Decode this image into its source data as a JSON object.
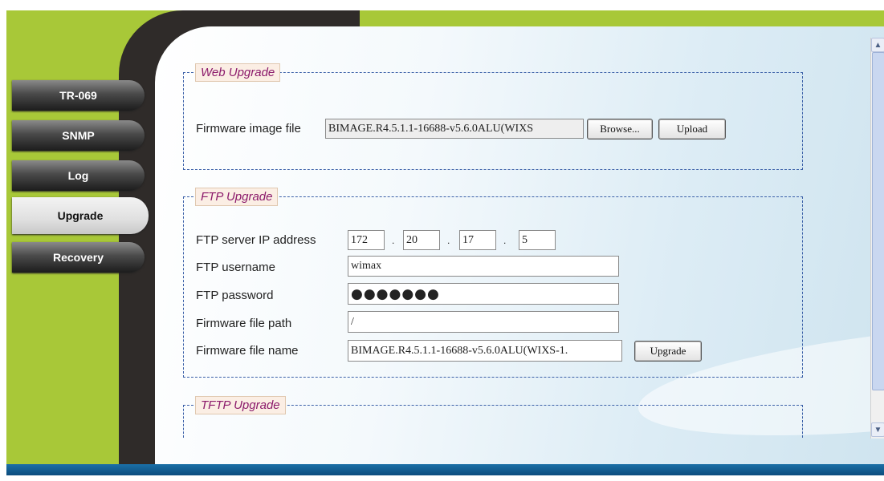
{
  "sidebar": {
    "items": [
      {
        "label": "TR-069"
      },
      {
        "label": "SNMP"
      },
      {
        "label": "Log"
      },
      {
        "label": "Upgrade"
      },
      {
        "label": "Recovery"
      }
    ]
  },
  "web_upgrade": {
    "legend": "Web Upgrade",
    "firmware_label": "Firmware image file",
    "firmware_value": "BIMAGE.R4.5.1.1-16688-v5.6.0ALU(WIXS",
    "browse_label": "Browse...",
    "upload_label": "Upload"
  },
  "ftp_upgrade": {
    "legend": "FTP Upgrade",
    "ip_label": "FTP server IP address",
    "ip": [
      "172",
      "20",
      "17",
      "5"
    ],
    "ip_separator": ".",
    "username_label": "FTP username",
    "username_value": "wimax",
    "password_label": "FTP password",
    "password_value": "●●●●●●●",
    "path_label": "Firmware file path",
    "path_value": "/",
    "name_label": "Firmware file name",
    "name_value": "BIMAGE.R4.5.1.1-16688-v5.6.0ALU(WIXS-1.",
    "upgrade_label": "Upgrade"
  },
  "tftp_upgrade": {
    "legend": "TFTP Upgrade"
  },
  "scrollbar": {
    "up_icon": "chevron-up-icon",
    "down_icon": "chevron-down-icon"
  }
}
